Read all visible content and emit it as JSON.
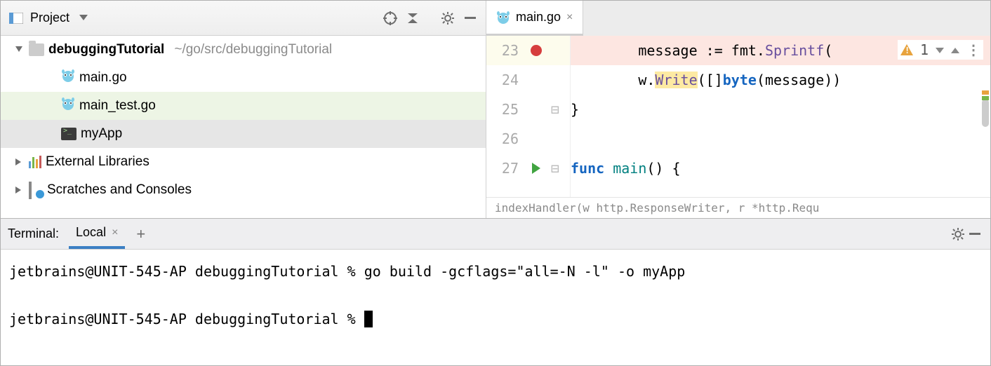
{
  "project": {
    "title": "Project",
    "root": {
      "name": "debuggingTutorial",
      "path": "~/go/src/debuggingTutorial"
    },
    "files": [
      {
        "name": "main.go",
        "kind": "go"
      },
      {
        "name": "main_test.go",
        "kind": "go",
        "highlight": "green"
      },
      {
        "name": "myApp",
        "kind": "bin",
        "highlight": "grey"
      }
    ],
    "extLibs": "External Libraries",
    "scratches": "Scratches and Consoles"
  },
  "editor": {
    "tab": "main.go",
    "warnCount": "1",
    "lines": [
      {
        "num": "23",
        "bp": true,
        "fold": "",
        "code_parts": [
          {
            "t": "        message ",
            "c": ""
          },
          {
            "t": ":=",
            "c": ""
          },
          {
            "t": " fmt.",
            "c": ""
          },
          {
            "t": "Sprintf",
            "c": "k-pur"
          },
          {
            "t": "(",
            "c": ""
          }
        ],
        "cur": true
      },
      {
        "num": "24",
        "bp": false,
        "fold": "",
        "code_parts": [
          {
            "t": "        w.",
            "c": ""
          },
          {
            "t": "Write",
            "c": "wr k-pur"
          },
          {
            "t": "([]",
            "c": ""
          },
          {
            "t": "byte",
            "c": "k-blue"
          },
          {
            "t": "(message))",
            "c": ""
          }
        ]
      },
      {
        "num": "25",
        "bp": false,
        "fold": "⊟",
        "code_parts": [
          {
            "t": "}",
            "c": ""
          }
        ]
      },
      {
        "num": "26",
        "bp": false,
        "fold": "",
        "code_parts": []
      },
      {
        "num": "27",
        "bp": false,
        "run": true,
        "fold": "⊟",
        "code_parts": [
          {
            "t": "func ",
            "c": "k-blue"
          },
          {
            "t": "main",
            "c": "k-teal"
          },
          {
            "t": "() {",
            "c": ""
          }
        ]
      }
    ],
    "breadcrumb": "indexHandler(w http.ResponseWriter, r *http.Requ"
  },
  "terminal": {
    "title": "Terminal:",
    "tab": "Local",
    "lines": [
      "jetbrains@UNIT-545-AP debuggingTutorial % go build -gcflags=\"all=-N -l\" -o myApp",
      "",
      "jetbrains@UNIT-545-AP debuggingTutorial % "
    ]
  }
}
